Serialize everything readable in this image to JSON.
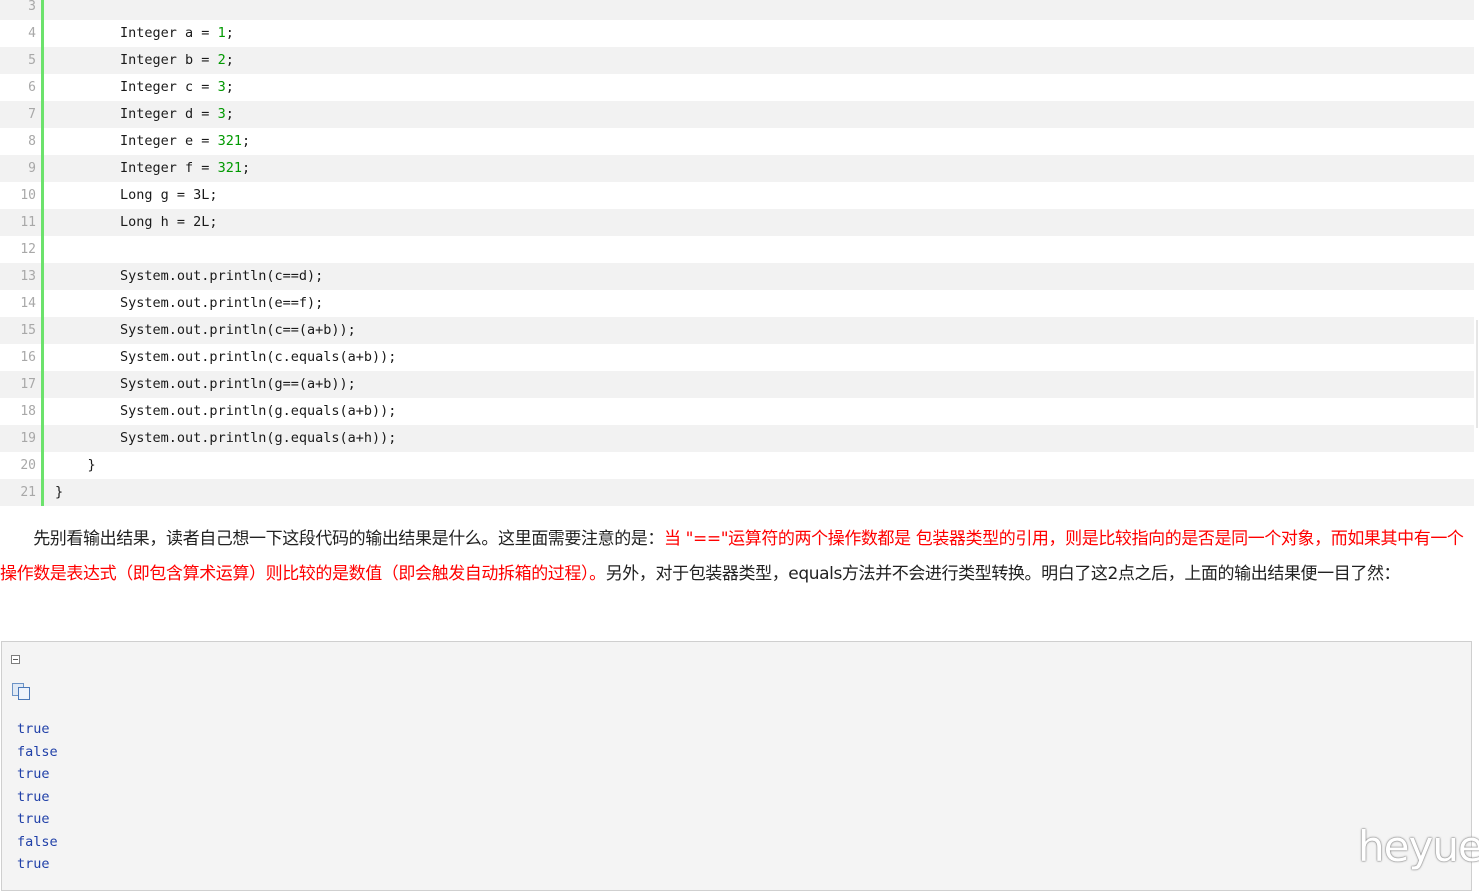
{
  "code": {
    "lines": [
      {
        "num": "3",
        "indent": "",
        "text": "",
        "literal": "",
        "tail": ""
      },
      {
        "num": "4",
        "indent": "        ",
        "text": "Integer a = ",
        "literal": "1",
        "tail": ";"
      },
      {
        "num": "5",
        "indent": "        ",
        "text": "Integer b = ",
        "literal": "2",
        "tail": ";"
      },
      {
        "num": "6",
        "indent": "        ",
        "text": "Integer c = ",
        "literal": "3",
        "tail": ";"
      },
      {
        "num": "7",
        "indent": "        ",
        "text": "Integer d = ",
        "literal": "3",
        "tail": ";"
      },
      {
        "num": "8",
        "indent": "        ",
        "text": "Integer e = ",
        "literal": "321",
        "tail": ";"
      },
      {
        "num": "9",
        "indent": "        ",
        "text": "Integer f = ",
        "literal": "321",
        "tail": ";"
      },
      {
        "num": "10",
        "indent": "        ",
        "text": "Long g = 3L;",
        "literal": "",
        "tail": ""
      },
      {
        "num": "11",
        "indent": "        ",
        "text": "Long h = 2L;",
        "literal": "",
        "tail": ""
      },
      {
        "num": "12",
        "indent": "",
        "text": "",
        "literal": "",
        "tail": ""
      },
      {
        "num": "13",
        "indent": "        ",
        "text": "System.out.println(c==d);",
        "literal": "",
        "tail": ""
      },
      {
        "num": "14",
        "indent": "        ",
        "text": "System.out.println(e==f);",
        "literal": "",
        "tail": ""
      },
      {
        "num": "15",
        "indent": "        ",
        "text": "System.out.println(c==(a+b));",
        "literal": "",
        "tail": ""
      },
      {
        "num": "16",
        "indent": "        ",
        "text": "System.out.println(c.equals(a+b));",
        "literal": "",
        "tail": ""
      },
      {
        "num": "17",
        "indent": "        ",
        "text": "System.out.println(g==(a+b));",
        "literal": "",
        "tail": ""
      },
      {
        "num": "18",
        "indent": "        ",
        "text": "System.out.println(g.equals(a+b));",
        "literal": "",
        "tail": ""
      },
      {
        "num": "19",
        "indent": "        ",
        "text": "System.out.println(g.equals(a+h));",
        "literal": "",
        "tail": ""
      },
      {
        "num": "20",
        "indent": "    ",
        "text": "}",
        "literal": "",
        "tail": ""
      },
      {
        "num": "21",
        "indent": "",
        "text": "}",
        "literal": "",
        "tail": ""
      }
    ]
  },
  "paragraph": {
    "intro": "　　先别看输出结果，读者自己想一下这段代码的输出结果是什么。这里面需要注意的是：",
    "highlight": "当 \"==\"运算符的两个操作数都是 包装器类型的引用，则是比较指向的是否是同一个对象，而如果其中有一个操作数是表达式（即包含算术运算）则比较的是数值（即会触发自动拆箱的过程）。",
    "rest": "另外，对于包装器类型，equals方法并不会进行类型转换。明白了这2点之后，上面的输出结果便一目了然："
  },
  "output": {
    "lines": [
      "true",
      "false",
      "true",
      "true",
      "true",
      "false",
      "true"
    ]
  },
  "watermark": "heyue",
  "colors": {
    "gutter_bar": "#6ce26c",
    "number_literal": "#009900",
    "highlight_text": "#ff0000",
    "output_text": "#2040a8"
  },
  "icons": {
    "collapse": "collapse-icon",
    "copy": "copy-icon"
  }
}
